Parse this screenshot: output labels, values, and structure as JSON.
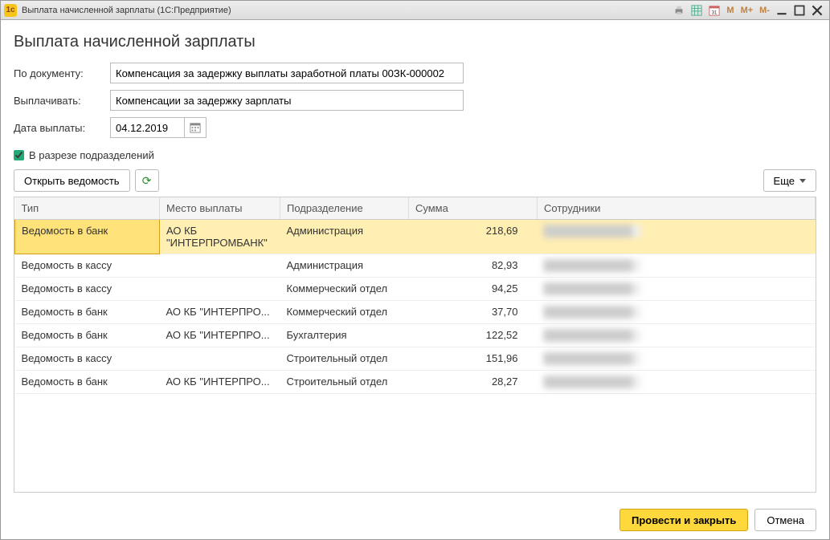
{
  "titlebar": {
    "title": "Выплата начисленной зарплаты  (1С:Предприятие)"
  },
  "page": {
    "title": "Выплата начисленной зарплаты"
  },
  "form": {
    "document_label": "По документу:",
    "document_value": "Компенсация за задержку выплаты заработной платы 00ЗК-000002",
    "pay_label": "Выплачивать:",
    "pay_value": "Компенсации за задержку зарплаты",
    "date_label": "Дата выплаты:",
    "date_value": "04.12.2019",
    "by_departments_label": "В разрезе подразделений"
  },
  "toolbar": {
    "open_statement": "Открыть ведомость",
    "more": "Еще"
  },
  "table": {
    "headers": {
      "type": "Тип",
      "place": "Место выплаты",
      "department": "Подразделение",
      "sum": "Сумма",
      "employees": "Сотрудники"
    },
    "rows": [
      {
        "type": "Ведомость в банк",
        "place": "АО КБ \"ИНТЕРПРОМБАНК\"",
        "department": "Администрация",
        "sum": "218,69",
        "selected": true
      },
      {
        "type": "Ведомость в кассу",
        "place": "",
        "department": "Администрация",
        "sum": "82,93"
      },
      {
        "type": "Ведомость в кассу",
        "place": "",
        "department": "Коммерческий отдел",
        "sum": "94,25"
      },
      {
        "type": "Ведомость в банк",
        "place": "АО КБ \"ИНТЕРПРО...",
        "department": "Коммерческий отдел",
        "sum": "37,70"
      },
      {
        "type": "Ведомость в банк",
        "place": "АО КБ \"ИНТЕРПРО...",
        "department": "Бухгалтерия",
        "sum": "122,52"
      },
      {
        "type": "Ведомость в кассу",
        "place": "",
        "department": "Строительный отдел",
        "sum": "151,96"
      },
      {
        "type": "Ведомость в банк",
        "place": "АО КБ \"ИНТЕРПРО...",
        "department": "Строительный отдел",
        "sum": "28,27"
      }
    ]
  },
  "footer": {
    "submit": "Провести  и закрыть",
    "cancel": "Отмена"
  }
}
